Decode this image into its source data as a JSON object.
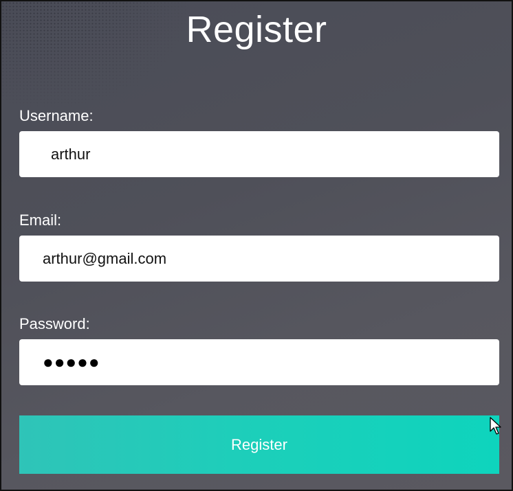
{
  "form": {
    "title": "Register",
    "username": {
      "label": "Username:",
      "value": "arthur"
    },
    "email": {
      "label": "Email:",
      "value": "arthur@gmail.com"
    },
    "password": {
      "label": "Password:",
      "masked_value": "●●●●●"
    },
    "submit_label": "Register"
  },
  "colors": {
    "panel_background": "#4f5059",
    "button_accent": "#1ccfba",
    "field_background": "#ffffff",
    "text": "#ffffff"
  },
  "icons": [
    "mouse-pointer-icon"
  ]
}
